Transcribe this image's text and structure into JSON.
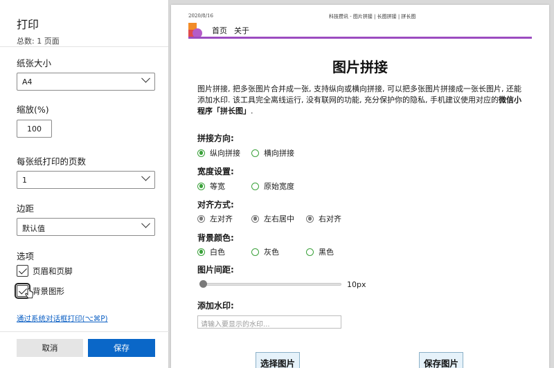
{
  "print_panel": {
    "title": "打印",
    "page_count": "总数: 1 页面",
    "paper_size": {
      "label": "纸张大小",
      "value": "A4"
    },
    "scale": {
      "label": "缩放(%)",
      "value": "100"
    },
    "pages_per_sheet": {
      "label": "每张纸打印的页数",
      "value": "1"
    },
    "margins": {
      "label": "边距",
      "value": "默认值"
    },
    "options": {
      "label": "选项",
      "headers_footers": "页眉和页脚",
      "background_graphics": "背景图形"
    },
    "system_dialog_link": "通过系统对话框打印(⌥⌘P)",
    "cancel_label": "取消",
    "save_label": "保存"
  },
  "preview": {
    "date": "2020/8/16",
    "header_title": "科技攒讯 - 图片拼接 | 长图拼接 | 拼长图",
    "nav": [
      "首页",
      "关于"
    ],
    "title": "图片拼接",
    "description": "图片拼接, 把多张图片合并成一张, 支持纵向或横向拼接, 可以把多张图片拼接成一张长图片, 还能添加水印. 该工具完全离线运行, 没有联网的功能, 充分保护你的隐私, 手机建议使用对应的",
    "description_bold": "微信小程序「拼长图」",
    "description_end": ".",
    "direction": {
      "label": "拼接方向:",
      "options": [
        "纵向拼接",
        "横向拼接"
      ]
    },
    "width": {
      "label": "宽度设置:",
      "options": [
        "等宽",
        "原始宽度"
      ]
    },
    "align": {
      "label": "对齐方式:",
      "options": [
        "左对齐",
        "左右居中",
        "右对齐"
      ]
    },
    "bg_color": {
      "label": "背景颜色:",
      "options": [
        "白色",
        "灰色",
        "黑色"
      ]
    },
    "spacing": {
      "label": "图片间距:",
      "value": "10px"
    },
    "watermark": {
      "label": "添加水印:",
      "placeholder": "请输入要显示的水印..."
    },
    "buttons": {
      "select": "选择图片",
      "save": "保存图片"
    }
  },
  "colors": {
    "accent_blue": "#0a67c8",
    "radio_green": "#3aa13a",
    "nav_line": "#9b4cc0"
  }
}
